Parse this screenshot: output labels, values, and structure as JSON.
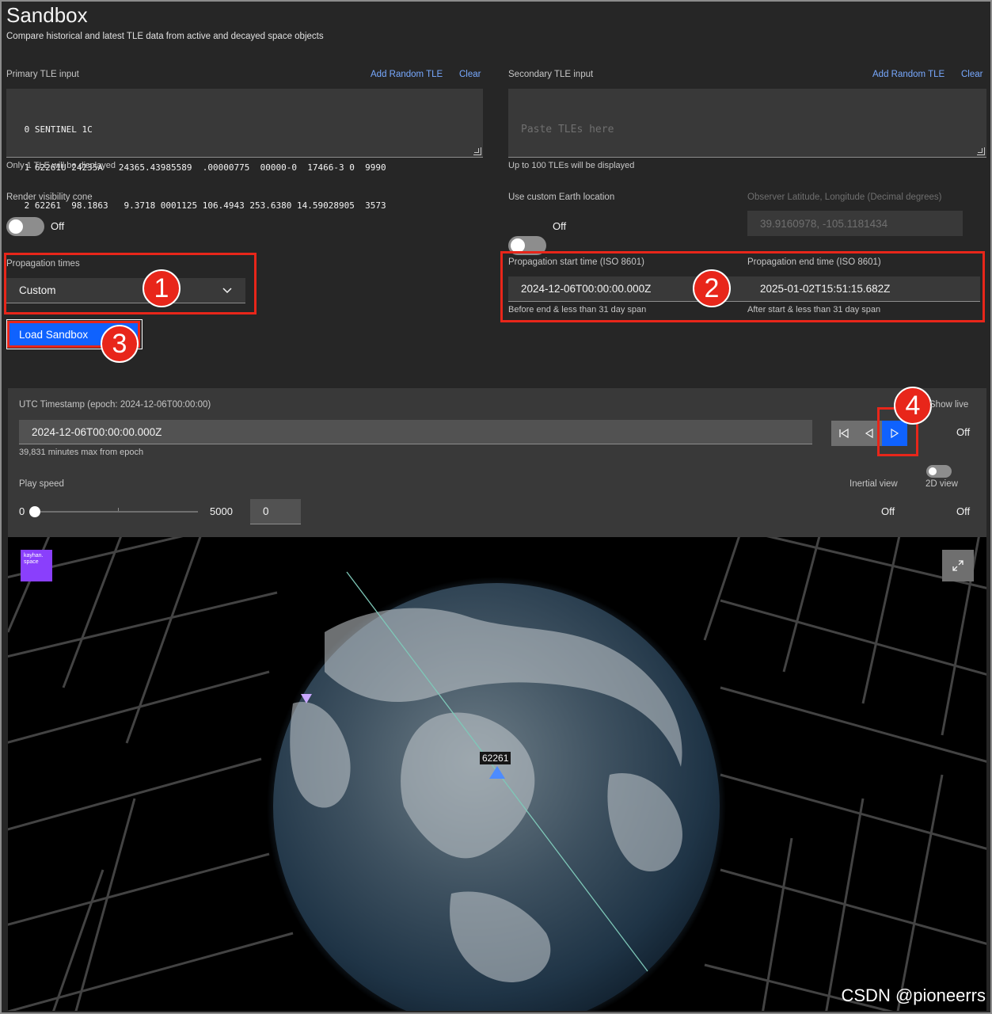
{
  "header": {
    "title": "Sandbox",
    "subtitle": "Compare historical and latest TLE data from active and decayed space objects"
  },
  "primary": {
    "label": "Primary TLE input",
    "add_random": "Add Random TLE",
    "clear": "Clear",
    "tle_lines": [
      " 0 SENTINEL 1C",
      " 1 62261U 24235A   24365.43985589  .00000775  00000-0  17466-3 0  9990",
      " 2 62261  98.1863   9.3718 0001125 106.4943 253.6380 14.59028905  3573"
    ],
    "helper": "Only 1 TLE will be displayed"
  },
  "secondary": {
    "label": "Secondary TLE input",
    "add_random": "Add Random TLE",
    "clear": "Clear",
    "placeholder": "Paste TLEs here",
    "helper": "Up to 100 TLEs will be displayed"
  },
  "visibility_cone": {
    "label": "Render visibility cone",
    "state": "Off"
  },
  "custom_location": {
    "label": "Use custom Earth location",
    "state": "Off",
    "observer_label": "Observer Latitude, Longitude (Decimal degrees)",
    "observer_value": "39.9160978, -105.1181434"
  },
  "propagation": {
    "times_label": "Propagation times",
    "times_value": "Custom",
    "start_label": "Propagation start time (ISO 8601)",
    "start_value": "2024-12-06T00:00:00.000Z",
    "start_helper": "Before end & less than 31 day span",
    "end_label": "Propagation end time (ISO 8601)",
    "end_value": "2025-01-02T15:51:15.682Z",
    "end_helper": "After start & less than 31 day span"
  },
  "load_button": "Load Sandbox",
  "player": {
    "utc_label": "UTC Timestamp (epoch: 2024-12-06T00:00:00)",
    "utc_value": "2024-12-06T00:00:00.000Z",
    "utc_helper": "39,831 minutes max from epoch",
    "show_live_label": "Show live",
    "show_live_state": "Off",
    "play_speed_label": "Play speed",
    "speed_min": "0",
    "speed_max": "5000",
    "speed_value": "0",
    "speed_fraction": 0,
    "inertial_label": "Inertial view",
    "inertial_state": "Off",
    "view2d_label": "2D view",
    "view2d_state": "Off"
  },
  "viewer": {
    "logo_text": "kayhan.\nspace",
    "satellite_label": "62261"
  },
  "annotations": [
    "1",
    "2",
    "3",
    "4"
  ],
  "watermark": "CSDN @pioneerrs",
  "colors": {
    "background": "#262626",
    "accent": "#0f62fe",
    "link": "#78a9ff",
    "annotation": "#e8261a",
    "logo": "#8a3ffc"
  }
}
